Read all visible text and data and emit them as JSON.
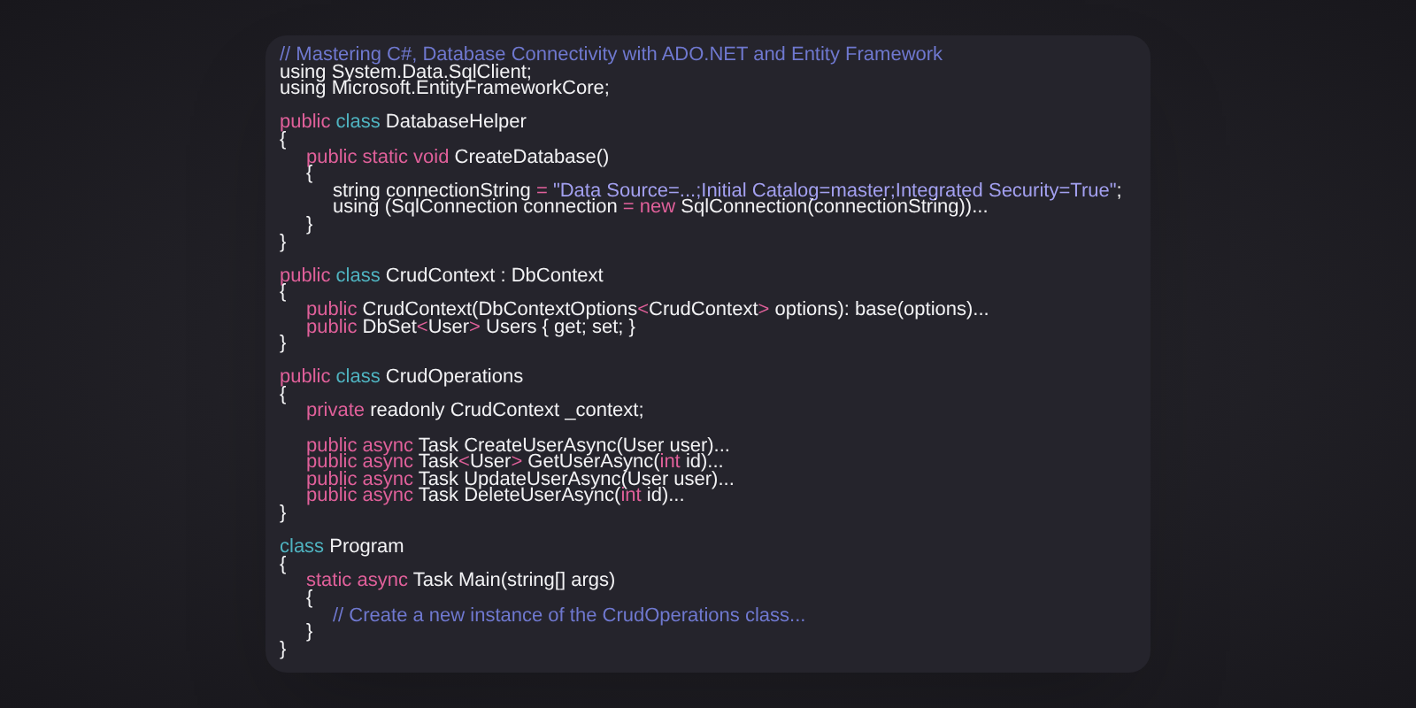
{
  "code_lines": [
    {
      "kind": "code",
      "tokens": [
        {
          "kind": "comment",
          "text": "// Mastering C#, Database Connectivity with ADO.NET and Entity Framework"
        }
      ]
    },
    {
      "kind": "code",
      "tokens": [
        {
          "kind": "plain",
          "text": "using System.Data.SqlClient;"
        }
      ]
    },
    {
      "kind": "code",
      "tokens": [
        {
          "kind": "plain",
          "text": "using Microsoft.EntityFrameworkCore;"
        }
      ]
    },
    {
      "kind": "blank"
    },
    {
      "kind": "code",
      "tokens": [
        {
          "kind": "keyword",
          "text": "public "
        },
        {
          "kind": "type",
          "text": "class "
        },
        {
          "kind": "plain",
          "text": "DatabaseHelper"
        }
      ]
    },
    {
      "kind": "code",
      "tokens": [
        {
          "kind": "plain",
          "text": "{"
        }
      ],
      "children": [
        {
          "kind": "code",
          "tokens": [
            {
              "kind": "keyword",
              "text": "public static void "
            },
            {
              "kind": "plain",
              "text": "CreateDatabase()"
            }
          ]
        },
        {
          "kind": "code",
          "tokens": [
            {
              "kind": "plain",
              "text": "{"
            }
          ],
          "children": [
            {
              "kind": "code",
              "tokens": [
                {
                  "kind": "plain",
                  "text": "string connectionString "
                },
                {
                  "kind": "keyword",
                  "text": "= "
                },
                {
                  "kind": "string",
                  "text": "\"Data Source=...;Initial Catalog=master;Integrated Security=True\""
                },
                {
                  "kind": "plain",
                  "text": ";"
                }
              ]
            },
            {
              "kind": "code",
              "tokens": [
                {
                  "kind": "plain",
                  "text": "using (SqlConnection connection "
                },
                {
                  "kind": "keyword",
                  "text": "= new "
                },
                {
                  "kind": "plain",
                  "text": "SqlConnection(connectionString))..."
                }
              ]
            }
          ]
        },
        {
          "kind": "code",
          "tokens": [
            {
              "kind": "plain",
              "text": "}"
            }
          ]
        }
      ]
    },
    {
      "kind": "code",
      "tokens": [
        {
          "kind": "plain",
          "text": "}"
        }
      ]
    },
    {
      "kind": "blank"
    },
    {
      "kind": "code",
      "tokens": [
        {
          "kind": "keyword",
          "text": "public "
        },
        {
          "kind": "type",
          "text": "class "
        },
        {
          "kind": "plain",
          "text": "CrudContext : DbContext"
        }
      ]
    },
    {
      "kind": "code",
      "tokens": [
        {
          "kind": "plain",
          "text": "{"
        }
      ],
      "children": [
        {
          "kind": "code",
          "tokens": [
            {
              "kind": "keyword",
              "text": "public "
            },
            {
              "kind": "plain",
              "text": "CrudContext(DbContextOptions"
            },
            {
              "kind": "keyword",
              "text": "<"
            },
            {
              "kind": "plain",
              "text": "CrudContext"
            },
            {
              "kind": "keyword",
              "text": "> "
            },
            {
              "kind": "plain",
              "text": "options): base(options)..."
            }
          ]
        },
        {
          "kind": "code",
          "tokens": [
            {
              "kind": "keyword",
              "text": "public "
            },
            {
              "kind": "plain",
              "text": "DbSet"
            },
            {
              "kind": "keyword",
              "text": "<"
            },
            {
              "kind": "plain",
              "text": "User"
            },
            {
              "kind": "keyword",
              "text": "> "
            },
            {
              "kind": "plain",
              "text": "Users { get; set; }"
            }
          ]
        }
      ]
    },
    {
      "kind": "code",
      "tokens": [
        {
          "kind": "plain",
          "text": "}"
        }
      ]
    },
    {
      "kind": "blank"
    },
    {
      "kind": "code",
      "tokens": [
        {
          "kind": "keyword",
          "text": "public "
        },
        {
          "kind": "type",
          "text": "class "
        },
        {
          "kind": "plain",
          "text": "CrudOperations"
        }
      ]
    },
    {
      "kind": "code",
      "tokens": [
        {
          "kind": "plain",
          "text": "{"
        }
      ],
      "children": [
        {
          "kind": "code",
          "tokens": [
            {
              "kind": "keyword",
              "text": "private "
            },
            {
              "kind": "plain",
              "text": "readonly CrudContext _context;"
            }
          ]
        },
        {
          "kind": "blank"
        },
        {
          "kind": "code",
          "tokens": [
            {
              "kind": "keyword",
              "text": "public async "
            },
            {
              "kind": "plain",
              "text": "Task CreateUserAsync(User user)..."
            }
          ]
        },
        {
          "kind": "code",
          "tokens": [
            {
              "kind": "keyword",
              "text": "public async "
            },
            {
              "kind": "plain",
              "text": "Task"
            },
            {
              "kind": "keyword",
              "text": "<"
            },
            {
              "kind": "plain",
              "text": "User"
            },
            {
              "kind": "keyword",
              "text": "> "
            },
            {
              "kind": "plain",
              "text": "GetUserAsync("
            },
            {
              "kind": "keyword",
              "text": "int "
            },
            {
              "kind": "plain",
              "text": "id)..."
            }
          ]
        },
        {
          "kind": "code",
          "tokens": [
            {
              "kind": "keyword",
              "text": "public async "
            },
            {
              "kind": "plain",
              "text": "Task UpdateUserAsync(User user)..."
            }
          ]
        },
        {
          "kind": "code",
          "tokens": [
            {
              "kind": "keyword",
              "text": "public async "
            },
            {
              "kind": "plain",
              "text": "Task DeleteUserAsync("
            },
            {
              "kind": "keyword",
              "text": "int "
            },
            {
              "kind": "plain",
              "text": "id)..."
            }
          ]
        }
      ]
    },
    {
      "kind": "code",
      "tokens": [
        {
          "kind": "plain",
          "text": "}"
        }
      ]
    },
    {
      "kind": "blank"
    },
    {
      "kind": "code",
      "tokens": [
        {
          "kind": "type",
          "text": "class "
        },
        {
          "kind": "plain",
          "text": "Program"
        }
      ]
    },
    {
      "kind": "code",
      "tokens": [
        {
          "kind": "plain",
          "text": "{"
        }
      ],
      "children": [
        {
          "kind": "code",
          "tokens": [
            {
              "kind": "keyword",
              "text": "static async "
            },
            {
              "kind": "plain",
              "text": "Task Main(string[] args)"
            }
          ]
        },
        {
          "kind": "code",
          "tokens": [
            {
              "kind": "plain",
              "text": "{"
            }
          ],
          "children": [
            {
              "kind": "code",
              "tokens": [
                {
                  "kind": "comment",
                  "text": "// Create a new instance of the CrudOperations class..."
                }
              ]
            }
          ]
        },
        {
          "kind": "code",
          "tokens": [
            {
              "kind": "plain",
              "text": "}"
            }
          ]
        }
      ]
    },
    {
      "kind": "code",
      "tokens": [
        {
          "kind": "plain",
          "text": "}"
        }
      ]
    }
  ]
}
